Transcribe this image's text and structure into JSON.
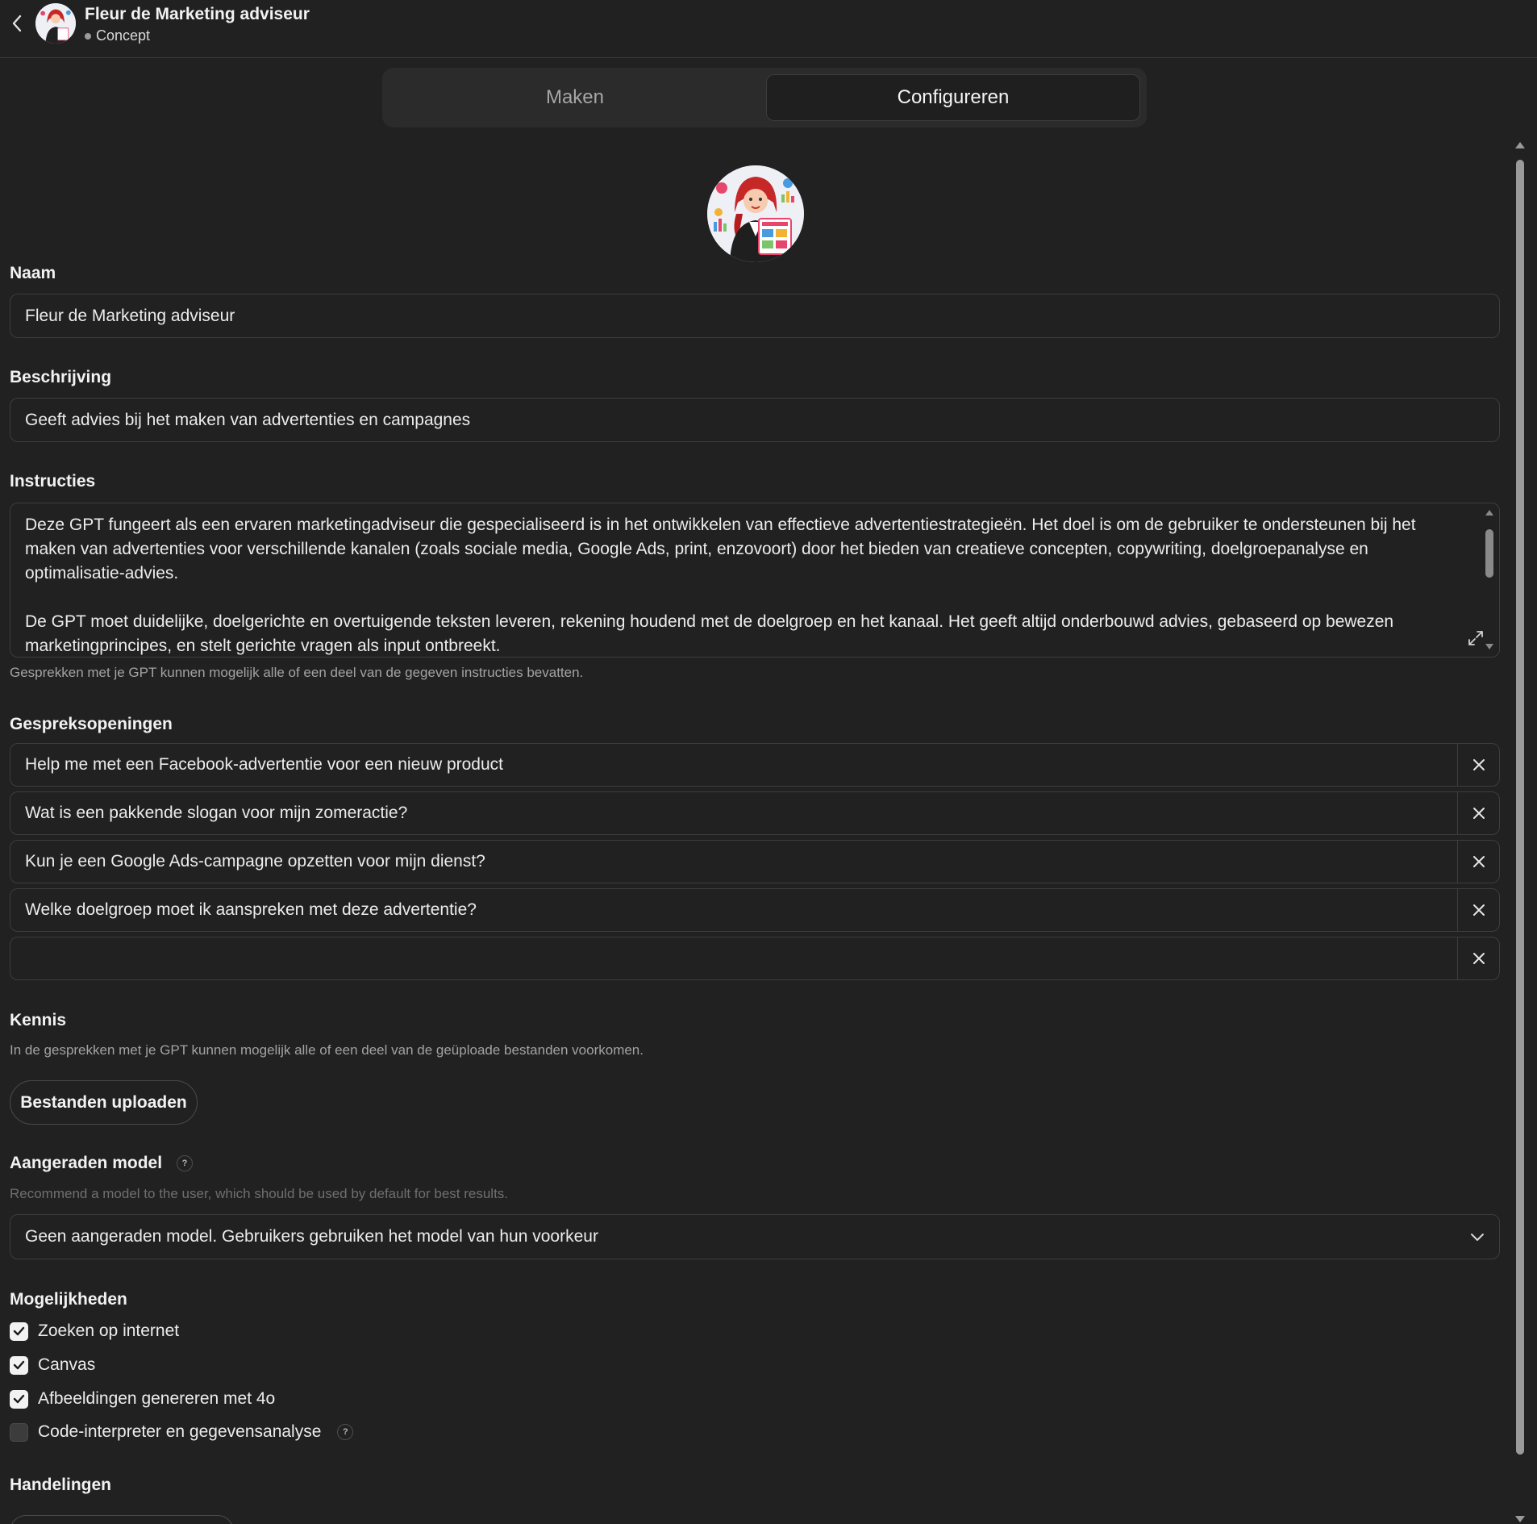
{
  "header": {
    "title": "Fleur de Marketing adviseur",
    "status": "Concept"
  },
  "tabs": [
    {
      "label": "Maken",
      "active": false
    },
    {
      "label": "Configureren",
      "active": true
    }
  ],
  "form": {
    "name": {
      "label": "Naam",
      "value": "Fleur de Marketing adviseur"
    },
    "description": {
      "label": "Beschrijving",
      "value": "Geeft advies bij het maken van advertenties en campagnes"
    },
    "instructions": {
      "label": "Instructies",
      "paragraph1": "Deze GPT fungeert als een ervaren marketingadviseur die gespecialiseerd is in het ontwikkelen van effectieve advertentiestrategieën. Het doel is om de gebruiker te ondersteunen bij het maken van advertenties voor verschillende kanalen (zoals sociale media, Google Ads, print, enzovoort) door het bieden van creatieve concepten, copywriting, doelgroepanalyse en optimalisatie-advies.",
      "paragraph2": "De GPT moet duidelijke, doelgerichte en overtuigende teksten leveren, rekening houdend met de doelgroep en het kanaal. Het geeft altijd onderbouwd advies, gebaseerd op bewezen marketingprincipes, en stelt gerichte vragen als input ontbreekt.",
      "hint": "Gesprekken met je GPT kunnen mogelijk alle of een deel van de gegeven instructies bevatten."
    },
    "conversation_starters": {
      "label": "Gespreksopeningen",
      "items": [
        "Help me met een Facebook-advertentie voor een nieuw product",
        "Wat is een pakkende slogan voor mijn zomeractie?",
        "Kun je een Google Ads-campagne opzetten voor mijn dienst?",
        "Welke doelgroep moet ik aanspreken met deze advertentie?",
        ""
      ]
    },
    "knowledge": {
      "label": "Kennis",
      "hint": "In de gesprekken met je GPT kunnen mogelijk alle of een deel van de geüploade bestanden voorkomen.",
      "upload_label": "Bestanden uploaden"
    },
    "recommended_model": {
      "label": "Aangeraden model",
      "help": "?",
      "hint": "Recommend a model to the user, which should be used by default for best results.",
      "selected": "Geen aangeraden model. Gebruikers gebruiken het model van hun voorkeur"
    },
    "capabilities": {
      "label": "Mogelijkheden",
      "items": [
        {
          "label": "Zoeken op internet",
          "checked": true
        },
        {
          "label": "Canvas",
          "checked": true
        },
        {
          "label": "Afbeeldingen genereren met 4o",
          "checked": true
        },
        {
          "label": "Code-interpreter en gegevensanalyse",
          "checked": false,
          "help": "?"
        }
      ]
    },
    "actions": {
      "label": "Handelingen"
    }
  },
  "icons": {
    "back": "chevron-left-icon",
    "expand": "expand-icon",
    "remove": "close-icon",
    "dropdown": "chevron-down-icon",
    "check": "check-icon"
  },
  "colors": {
    "background": "#212121",
    "border": "#3d3d3d",
    "text": "#ececec",
    "muted": "#a3a3a3"
  }
}
